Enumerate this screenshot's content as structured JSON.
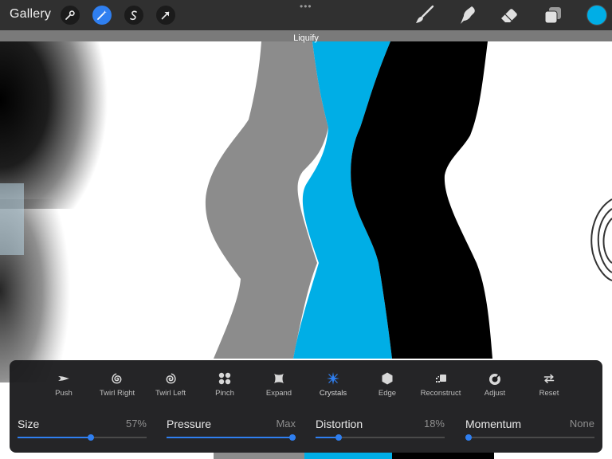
{
  "toolbar": {
    "gallery_label": "Gallery",
    "left_tools": [
      {
        "name": "Actions",
        "icon": "wrench-icon"
      },
      {
        "name": "Adjustments",
        "icon": "magic-wand-icon",
        "active": true
      },
      {
        "name": "Selection",
        "icon": "selection-s-icon"
      },
      {
        "name": "Transform",
        "icon": "arrow-cursor-icon"
      }
    ],
    "right_tools": [
      {
        "name": "Brush",
        "icon": "brush-icon"
      },
      {
        "name": "Smudge",
        "icon": "smudge-finger-icon"
      },
      {
        "name": "Eraser",
        "icon": "eraser-icon"
      },
      {
        "name": "Layers",
        "icon": "layers-icon"
      }
    ],
    "more_icon": "ellipsis-icon",
    "current_color": "#00aee6"
  },
  "mode_bar": {
    "label": "Liquify"
  },
  "liquify": {
    "modes": [
      {
        "label": "Push",
        "icon": "push-icon"
      },
      {
        "label": "Twirl Right",
        "icon": "twirl-right-icon"
      },
      {
        "label": "Twirl Left",
        "icon": "twirl-left-icon"
      },
      {
        "label": "Pinch",
        "icon": "pinch-icon"
      },
      {
        "label": "Expand",
        "icon": "expand-icon"
      },
      {
        "label": "Crystals",
        "icon": "crystals-icon",
        "active": true
      },
      {
        "label": "Edge",
        "icon": "edge-icon"
      },
      {
        "label": "Reconstruct",
        "icon": "reconstruct-icon"
      },
      {
        "label": "Adjust",
        "icon": "adjust-icon"
      },
      {
        "label": "Reset",
        "icon": "reset-icon"
      }
    ],
    "sliders": [
      {
        "label": "Size",
        "value_text": "57%",
        "value": 0.57
      },
      {
        "label": "Pressure",
        "value_text": "Max",
        "value": 1.0
      },
      {
        "label": "Distortion",
        "value_text": "18%",
        "value": 0.18
      },
      {
        "label": "Momentum",
        "value_text": "None",
        "value": 0.0
      }
    ]
  },
  "colors": {
    "accent": "#2f7ff0",
    "stripe_gray": "#8c8c8c",
    "stripe_blue": "#00aee6",
    "stripe_black": "#000000"
  }
}
